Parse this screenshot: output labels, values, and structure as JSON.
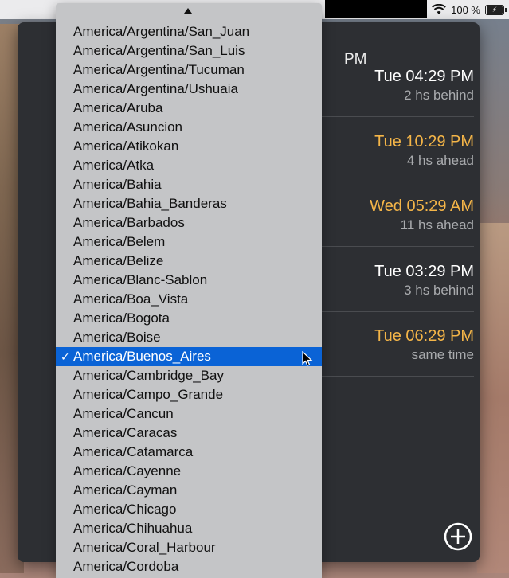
{
  "menubar": {
    "battery_percent": "100 %",
    "icons": [
      "wifi-icon",
      "battery-charging-icon"
    ]
  },
  "panel": {
    "title": "PM",
    "rows": [
      {
        "time": "Tue 04:29 PM",
        "diff": "2 hs behind",
        "highlight": false
      },
      {
        "time": "Tue 10:29 PM",
        "diff": "4 hs ahead",
        "highlight": true
      },
      {
        "time": "Wed 05:29 AM",
        "diff": "11 hs ahead",
        "highlight": true
      },
      {
        "time": "Tue 03:29 PM",
        "diff": "3 hs behind",
        "highlight": false
      },
      {
        "time": "Tue 06:29 PM",
        "diff": "same time",
        "highlight": true
      }
    ],
    "add_icon": "plus-circle-icon",
    "delete_icon": "trash-icon"
  },
  "dropdown": {
    "selected": "America/Buenos_Aires",
    "check_mark": "✓",
    "items": [
      "America/Argentina/San_Juan",
      "America/Argentina/San_Luis",
      "America/Argentina/Tucuman",
      "America/Argentina/Ushuaia",
      "America/Aruba",
      "America/Asuncion",
      "America/Atikokan",
      "America/Atka",
      "America/Bahia",
      "America/Bahia_Banderas",
      "America/Barbados",
      "America/Belem",
      "America/Belize",
      "America/Blanc-Sablon",
      "America/Boa_Vista",
      "America/Bogota",
      "America/Boise",
      "America/Buenos_Aires",
      "America/Cambridge_Bay",
      "America/Campo_Grande",
      "America/Cancun",
      "America/Caracas",
      "America/Catamarca",
      "America/Cayenne",
      "America/Cayman",
      "America/Chicago",
      "America/Chihuahua",
      "America/Coral_Harbour",
      "America/Cordoba"
    ]
  },
  "colors": {
    "panel_bg": "#2d2f33",
    "ahead_time": "#f4b548",
    "delete_red": "#e0241c",
    "selection_blue": "#0a63d6"
  }
}
